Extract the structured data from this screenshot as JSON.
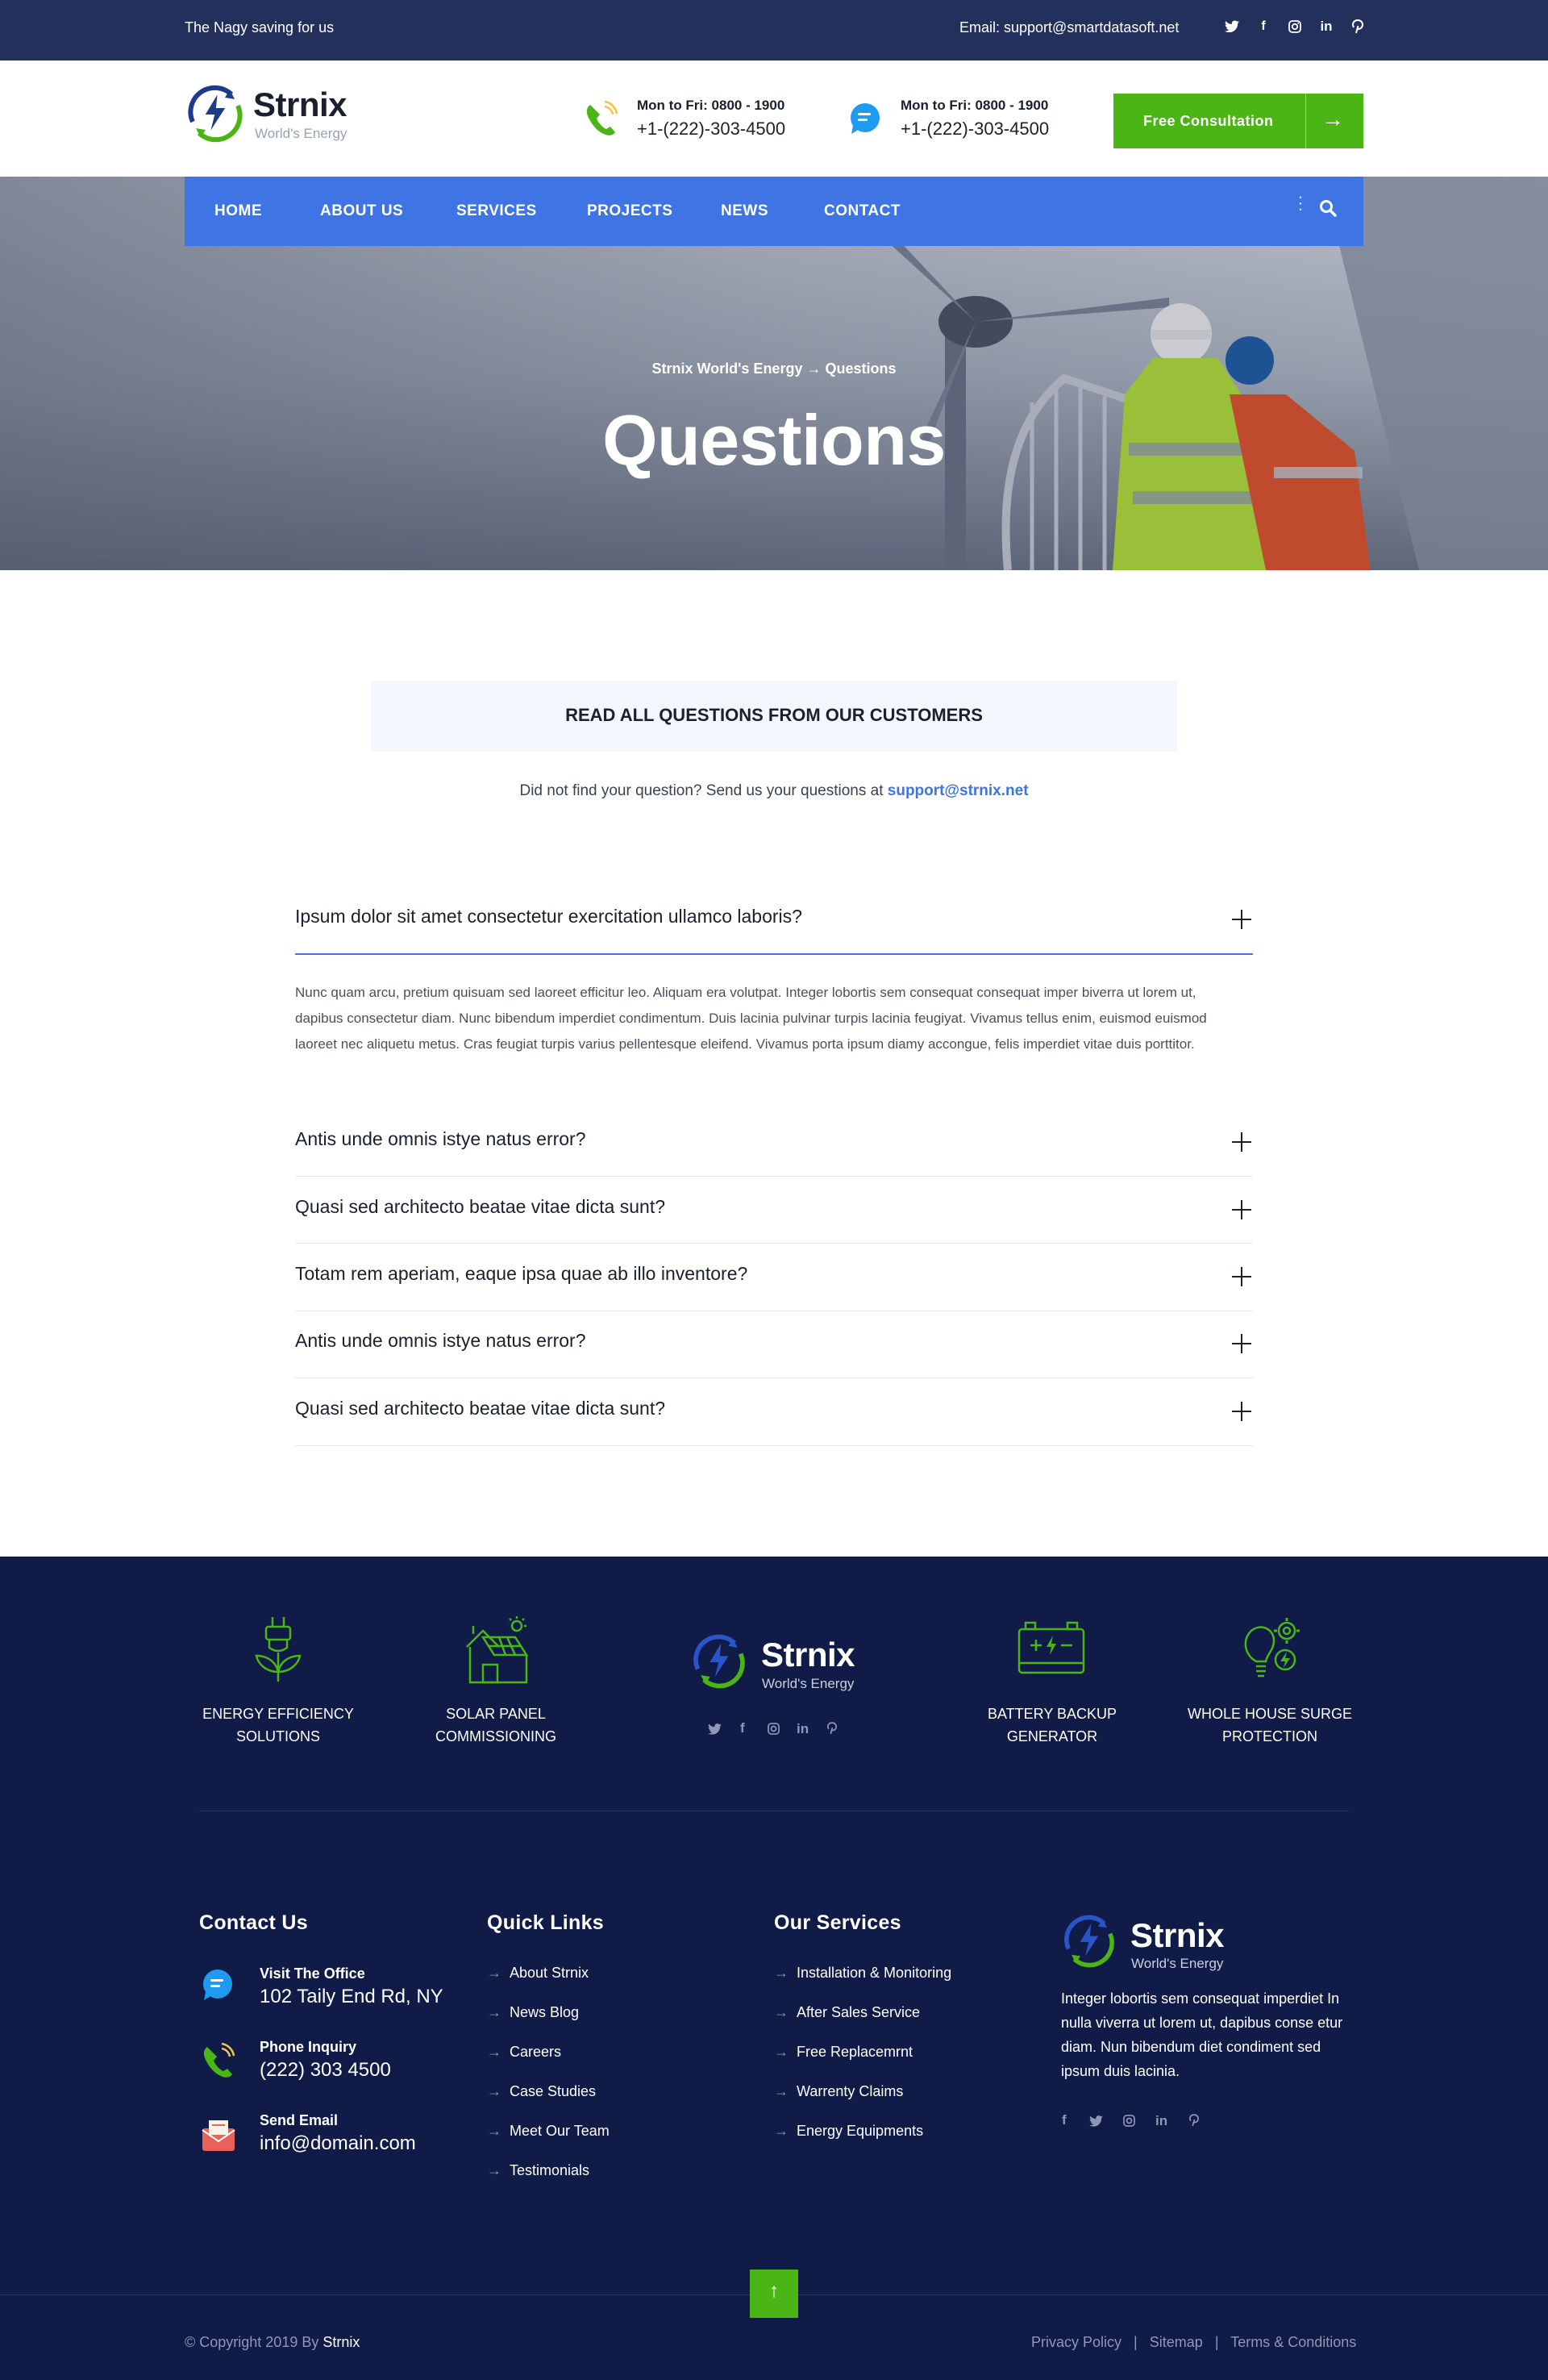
{
  "topbar": {
    "tagline": "The Nagy saving for us",
    "email": "Email: support@smartdatasoft.net",
    "social": [
      "twitter-icon",
      "facebook-icon",
      "instagram-icon",
      "linkedin-icon",
      "pinterest-icon"
    ]
  },
  "brand": {
    "name": "Strnix",
    "subtitle": "World's Energy"
  },
  "header": {
    "contact1": {
      "label": "Mon to Fri: 0800 - 1900",
      "value": "+1-(222)-303-4500"
    },
    "contact2": {
      "label": "Mon to Fri: 0800 - 1900",
      "value": "+1-(222)-303-4500"
    },
    "cta_label": "Free Consultation",
    "cta_arrow": "→"
  },
  "nav": {
    "items": [
      "HOME",
      "ABOUT US",
      "SERVICES",
      "PROJECTS",
      "NEWS",
      "CONTACT"
    ],
    "dots": "⋮"
  },
  "hero": {
    "breadcrumb_home": "Strnix World's Energy",
    "breadcrumb_sep": "→",
    "breadcrumb_current": "Questions",
    "title": "Questions"
  },
  "questions": {
    "heading": "READ ALL QUESTIONS FROM OUR CUSTOMERS",
    "subtext": "Did not find your question? Send us your questions at",
    "email": "support@strnix.net"
  },
  "faq": {
    "items": [
      "Ipsum dolor sit amet consectetur exercitation ullamco laboris?",
      "Antis unde omnis istye natus error?",
      "Quasi sed architecto beatae vitae dicta sunt?",
      "Totam rem aperiam, eaque ipsa quae ab illo inventore?",
      "Antis unde omnis istye natus error?",
      "Quasi sed architecto beatae vitae dicta sunt?"
    ],
    "answer": "Nunc quam arcu, pretium quisuam sed laoreet efficitur leo. Aliquam era volutpat. Integer lobortis sem consequat consequat imper biverra ut lorem ut, dapibus consectetur diam. Nunc bibendum imperdiet condimentum. Duis lacinia pulvinar turpis lacinia feugiyat. Vivamus tellus enim, euismod euismod laoreet nec aliquetu metus. Cras feugiat turpis varius pellentesque eleifend. Vivamus porta ipsum diamy accongue, felis imperdiet vitae duis porttitor."
  },
  "features": [
    {
      "line1": "ENERGY EFFICIENCY",
      "line2": "SOLUTIONS"
    },
    {
      "line1": "SOLAR PANEL",
      "line2": "COMMISSIONING"
    },
    {
      "line1": "BATTERY BACKUP",
      "line2": "GENERATOR"
    },
    {
      "line1": "WHOLE HOUSE SURGE",
      "line2": "PROTECTION"
    }
  ],
  "footer": {
    "contact": {
      "heading": "Contact Us",
      "office_label": "Visit The Office",
      "office_value": "102 Taily End Rd, NY",
      "phone_label": "Phone Inquiry",
      "phone_value": "(222) 303 4500",
      "email_label": "Send Email",
      "email_value": "info@domain.com"
    },
    "quick_links": {
      "heading": "Quick Links",
      "items": [
        "About Strnix",
        "News Blog",
        "Careers",
        "Case Studies",
        "Meet Our Team",
        "Testimonials"
      ]
    },
    "services": {
      "heading": "Our Services",
      "items": [
        "Installation & Monitoring",
        "After Sales Service",
        "Free Replacemrnt",
        "Warrenty Claims",
        "Energy Equipments"
      ]
    },
    "about": {
      "description": "Integer lobortis sem consequat imperdiet In nulla viverra ut lorem ut, dapibus conse etur diam. Nun bibendum diet condiment sed ipsum duis lacinia."
    },
    "arrow": "→",
    "copyright_prefix": "© Copyright 2019 By",
    "copyright_brand": "Strnix",
    "legal": [
      "Privacy Policy",
      "Sitemap",
      "Terms & Conditions"
    ],
    "legal_sep": "|",
    "to_top": "↑"
  },
  "colors": {
    "accent_green": "#4ab515",
    "nav_blue": "#3f74e4",
    "navy": "#101c47",
    "topbar": "#23305c"
  }
}
